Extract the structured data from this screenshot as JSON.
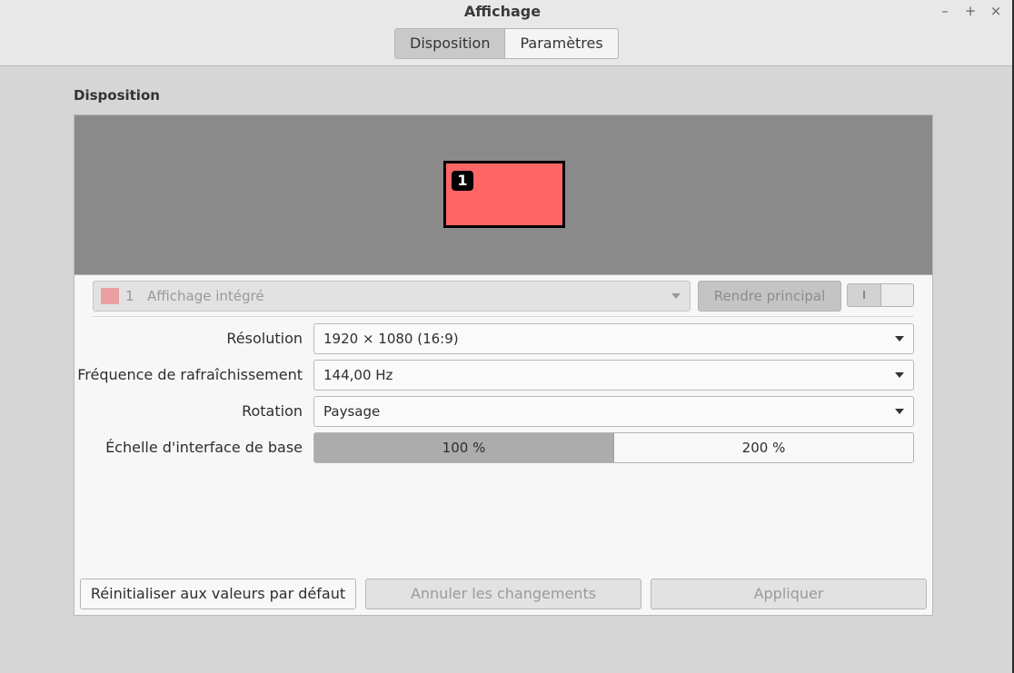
{
  "window": {
    "title": "Affichage",
    "controls": {
      "minimize": "–",
      "maximize": "+",
      "close": "×"
    }
  },
  "tabs": [
    {
      "label": "Disposition",
      "active": true
    },
    {
      "label": "Paramètres",
      "active": false
    }
  ],
  "section_title": "Disposition",
  "monitor": {
    "number": "1",
    "color": "#ff6666"
  },
  "monitor_select": {
    "number": "1",
    "name": "Affichage intégré",
    "swatch_color": "#eaa0a0"
  },
  "make_primary_label": "Rendre principal",
  "toggle_label": "I",
  "settings": {
    "resolution": {
      "label": "Résolution",
      "value": "1920 × 1080 (16:9)"
    },
    "refresh": {
      "label": "Fréquence de rafraîchissement",
      "value": "144,00 Hz"
    },
    "rotation": {
      "label": "Rotation",
      "value": "Paysage"
    },
    "scale": {
      "label": "Échelle d'interface de base",
      "options": [
        "100 %",
        "200 %"
      ],
      "selected": "100 %"
    }
  },
  "footer": {
    "reset": "Réinitialiser aux valeurs par défaut",
    "cancel": "Annuler les changements",
    "apply": "Appliquer"
  }
}
